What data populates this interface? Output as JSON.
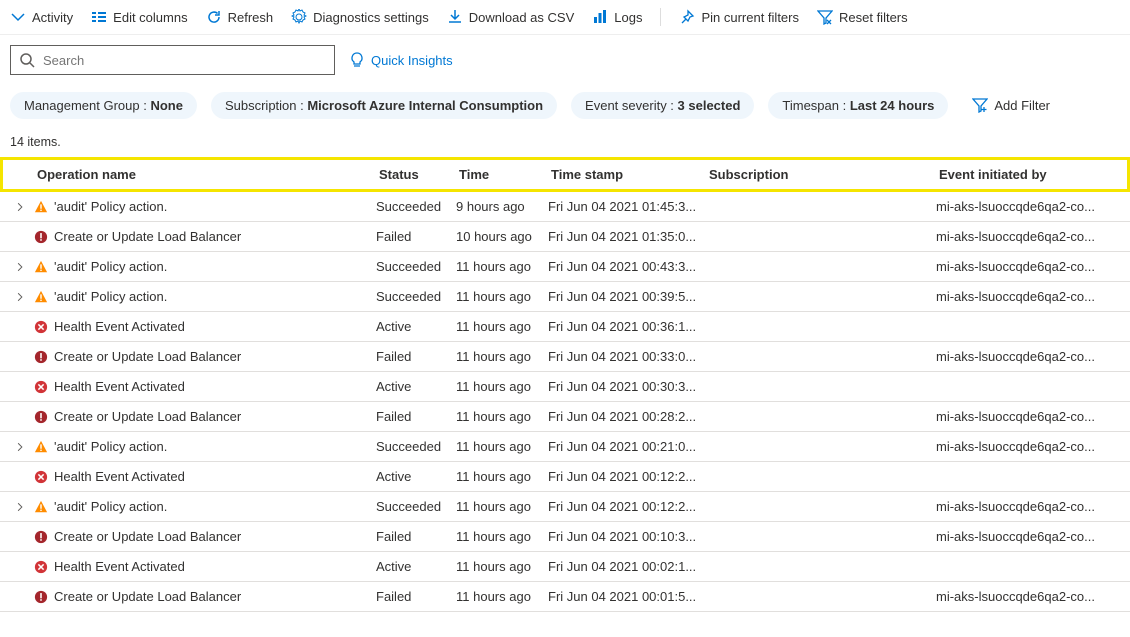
{
  "toolbar": {
    "activity": "Activity",
    "edit_columns": "Edit columns",
    "refresh": "Refresh",
    "diag": "Diagnostics settings",
    "download": "Download as CSV",
    "logs": "Logs",
    "pin": "Pin current filters",
    "reset": "Reset filters"
  },
  "search": {
    "placeholder": "Search"
  },
  "quick_insights": "Quick Insights",
  "pills": {
    "mg_label": "Management Group : ",
    "mg_value": "None",
    "sub_label": "Subscription : ",
    "sub_value": "Microsoft Azure Internal Consumption",
    "sev_label": "Event severity : ",
    "sev_value": "3 selected",
    "ts_label": "Timespan : ",
    "ts_value": "Last 24 hours",
    "add_filter": "Add Filter"
  },
  "count": "14 items.",
  "columns": {
    "op": "Operation name",
    "status": "Status",
    "time": "Time",
    "ts": "Time stamp",
    "sub": "Subscription",
    "eib": "Event initiated by"
  },
  "rows": [
    {
      "exp": true,
      "icon": "warn",
      "op": "'audit' Policy action.",
      "status": "Succeeded",
      "time": "9 hours ago",
      "ts": "Fri Jun 04 2021 01:45:3...",
      "sub": "",
      "eib": "mi-aks-lsuoccqde6qa2-co..."
    },
    {
      "exp": false,
      "icon": "err",
      "op": "Create or Update Load Balancer",
      "status": "Failed",
      "time": "10 hours ago",
      "ts": "Fri Jun 04 2021 01:35:0...",
      "sub": "",
      "eib": "mi-aks-lsuoccqde6qa2-co..."
    },
    {
      "exp": true,
      "icon": "warn",
      "op": "'audit' Policy action.",
      "status": "Succeeded",
      "time": "11 hours ago",
      "ts": "Fri Jun 04 2021 00:43:3...",
      "sub": "",
      "eib": "mi-aks-lsuoccqde6qa2-co..."
    },
    {
      "exp": true,
      "icon": "warn",
      "op": "'audit' Policy action.",
      "status": "Succeeded",
      "time": "11 hours ago",
      "ts": "Fri Jun 04 2021 00:39:5...",
      "sub": "",
      "eib": "mi-aks-lsuoccqde6qa2-co..."
    },
    {
      "exp": false,
      "icon": "errx",
      "op": "Health Event Activated",
      "status": "Active",
      "time": "11 hours ago",
      "ts": "Fri Jun 04 2021 00:36:1...",
      "sub": "",
      "eib": ""
    },
    {
      "exp": false,
      "icon": "err",
      "op": "Create or Update Load Balancer",
      "status": "Failed",
      "time": "11 hours ago",
      "ts": "Fri Jun 04 2021 00:33:0...",
      "sub": "",
      "eib": "mi-aks-lsuoccqde6qa2-co..."
    },
    {
      "exp": false,
      "icon": "errx",
      "op": "Health Event Activated",
      "status": "Active",
      "time": "11 hours ago",
      "ts": "Fri Jun 04 2021 00:30:3...",
      "sub": "",
      "eib": ""
    },
    {
      "exp": false,
      "icon": "err",
      "op": "Create or Update Load Balancer",
      "status": "Failed",
      "time": "11 hours ago",
      "ts": "Fri Jun 04 2021 00:28:2...",
      "sub": "",
      "eib": "mi-aks-lsuoccqde6qa2-co..."
    },
    {
      "exp": true,
      "icon": "warn",
      "op": "'audit' Policy action.",
      "status": "Succeeded",
      "time": "11 hours ago",
      "ts": "Fri Jun 04 2021 00:21:0...",
      "sub": "",
      "eib": "mi-aks-lsuoccqde6qa2-co..."
    },
    {
      "exp": false,
      "icon": "errx",
      "op": "Health Event Activated",
      "status": "Active",
      "time": "11 hours ago",
      "ts": "Fri Jun 04 2021 00:12:2...",
      "sub": "",
      "eib": ""
    },
    {
      "exp": true,
      "icon": "warn",
      "op": "'audit' Policy action.",
      "status": "Succeeded",
      "time": "11 hours ago",
      "ts": "Fri Jun 04 2021 00:12:2...",
      "sub": "",
      "eib": "mi-aks-lsuoccqde6qa2-co..."
    },
    {
      "exp": false,
      "icon": "err",
      "op": "Create or Update Load Balancer",
      "status": "Failed",
      "time": "11 hours ago",
      "ts": "Fri Jun 04 2021 00:10:3...",
      "sub": "",
      "eib": "mi-aks-lsuoccqde6qa2-co..."
    },
    {
      "exp": false,
      "icon": "errx",
      "op": "Health Event Activated",
      "status": "Active",
      "time": "11 hours ago",
      "ts": "Fri Jun 04 2021 00:02:1...",
      "sub": "",
      "eib": ""
    },
    {
      "exp": false,
      "icon": "err",
      "op": "Create or Update Load Balancer",
      "status": "Failed",
      "time": "11 hours ago",
      "ts": "Fri Jun 04 2021 00:01:5...",
      "sub": "",
      "eib": "mi-aks-lsuoccqde6qa2-co..."
    }
  ]
}
